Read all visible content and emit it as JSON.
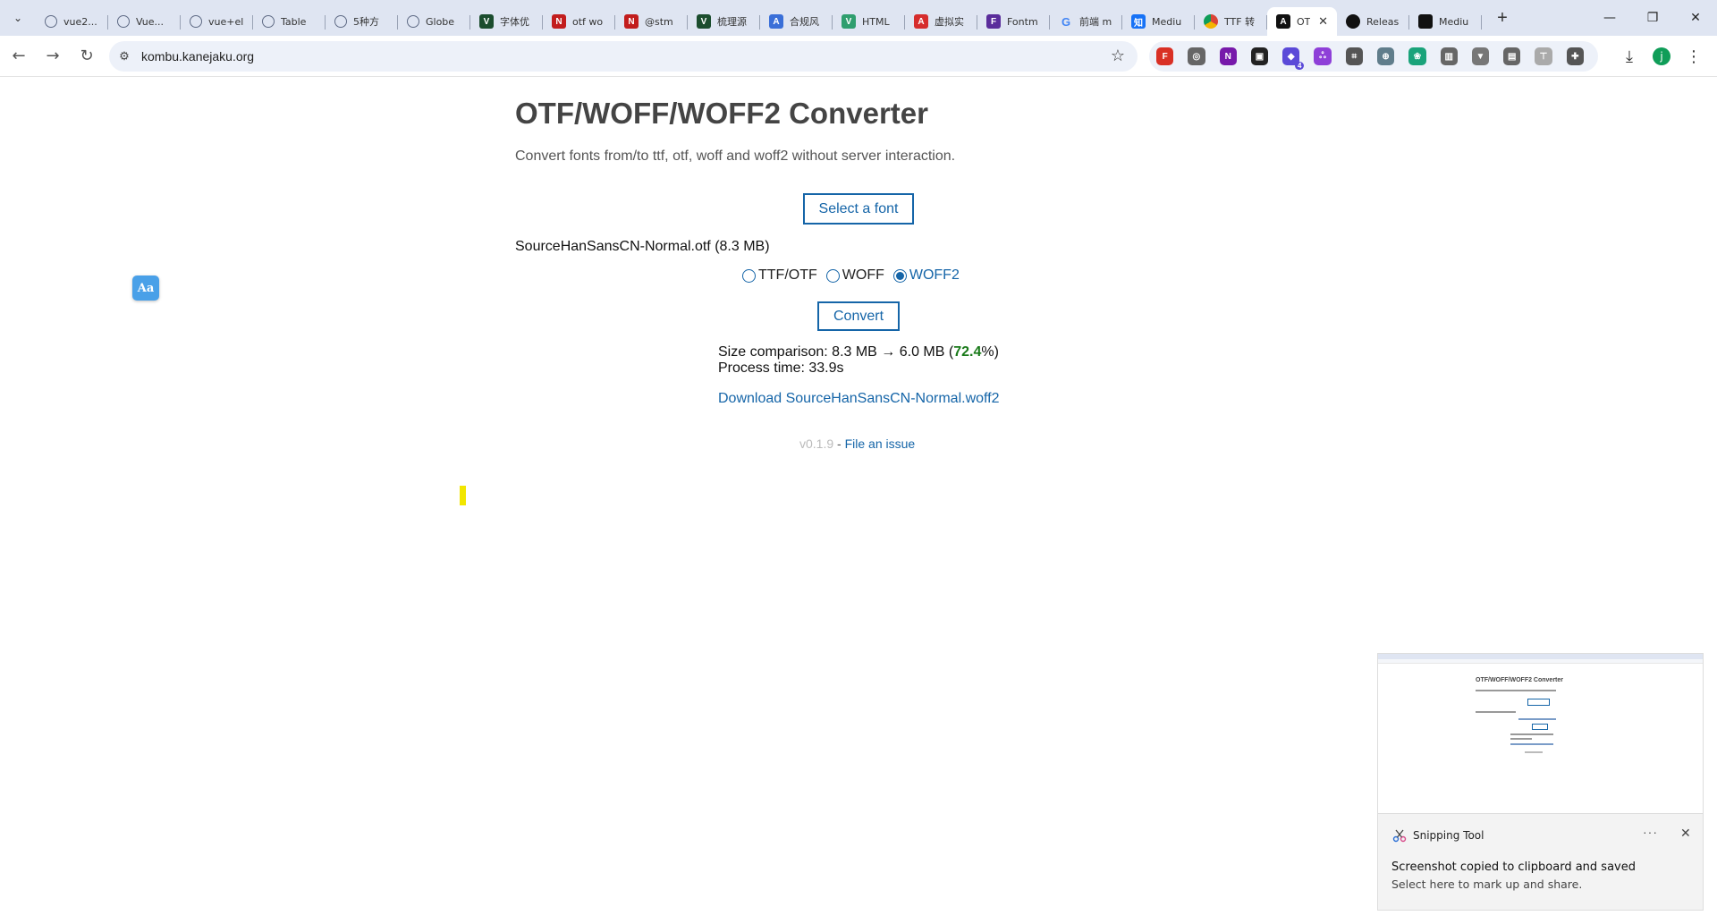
{
  "browser": {
    "tabs": [
      {
        "title": "vue2...",
        "icon": "globe-icon",
        "color": "#5f6b85"
      },
      {
        "title": "Vue...",
        "icon": "globe-icon",
        "color": "#5f6b85"
      },
      {
        "title": "vue+el",
        "icon": "globe-icon",
        "color": "#5f6b85"
      },
      {
        "title": "Table",
        "icon": "globe-icon",
        "color": "#5f6b85"
      },
      {
        "title": "5种方",
        "icon": "openai-icon",
        "color": "#5f6b85"
      },
      {
        "title": "Globe",
        "icon": "globe-icon",
        "color": "#5f6b85"
      },
      {
        "title": "字体优",
        "icon": "v-icon",
        "color": "#1b4d2e"
      },
      {
        "title": "otf wo",
        "icon": "n-icon",
        "color": "#c21d1d"
      },
      {
        "title": "@stm",
        "icon": "n-icon",
        "color": "#c21d1d"
      },
      {
        "title": "梳理源",
        "icon": "v-icon",
        "color": "#1b4d2e"
      },
      {
        "title": "合规风",
        "icon": "a-icon",
        "color": "#3a6fd8"
      },
      {
        "title": "HTML",
        "icon": "vue-icon",
        "color": "#2f9e6e"
      },
      {
        "title": "虚拟实",
        "icon": "a-icon",
        "color": "#d62d2d"
      },
      {
        "title": "Fontm",
        "icon": "f-icon",
        "color": "#5a2d9b"
      },
      {
        "title": "前端 m",
        "icon": "google-icon",
        "color": "#ffffff"
      },
      {
        "title": "Mediu",
        "icon": "zhihu-icon",
        "color": "#1772f6"
      },
      {
        "title": "TTF 转",
        "icon": "chrome-icon",
        "color": "#e9a23b"
      },
      {
        "title": "OT",
        "icon": "a-icon",
        "color": "#111111",
        "active": true
      },
      {
        "title": "Releas",
        "icon": "github-icon",
        "color": "#111111"
      },
      {
        "title": "Mediu",
        "icon": "medium-icon",
        "color": "#111111"
      }
    ],
    "tab_favicon_letters": [
      "",
      "",
      "",
      "",
      "",
      "",
      "V",
      "N",
      "N",
      "V",
      "A",
      "V",
      "A",
      "F",
      "G",
      "知",
      "",
      "A",
      "",
      ""
    ],
    "url": "kombu.kanejaku.org",
    "extensions": [
      {
        "name": "fire-extension-icon",
        "color": "#d93025",
        "letter": "F"
      },
      {
        "name": "globe-extension-icon",
        "color": "#666666",
        "letter": "◎"
      },
      {
        "name": "onenote-extension-icon",
        "color": "#7719aa",
        "letter": "N"
      },
      {
        "name": "puzzle-dark-extension-icon",
        "color": "#222222",
        "letter": "▣"
      },
      {
        "name": "stack-extension-icon",
        "color": "#5b4ad8",
        "letter": "◆",
        "badge": "4"
      },
      {
        "name": "translate-extension-icon",
        "color": "#8e3fd8",
        "letter": "ஃ"
      },
      {
        "name": "crop-extension-icon",
        "color": "#555555",
        "letter": "⌗"
      },
      {
        "name": "shield-extension-icon",
        "color": "#607d8b",
        "letter": "⊕"
      },
      {
        "name": "leaf-extension-icon",
        "color": "#1aa37a",
        "letter": "❀"
      },
      {
        "name": "trash-extension-icon",
        "color": "#666666",
        "letter": "▥"
      },
      {
        "name": "vue-devtools-extension-icon",
        "color": "#777777",
        "letter": "▼"
      },
      {
        "name": "image-extension-icon",
        "color": "#666666",
        "letter": "▤"
      },
      {
        "name": "filter-extension-icon",
        "color": "#aaaaaa",
        "letter": "⊤"
      },
      {
        "name": "extensions-puzzle-icon",
        "color": "#555555",
        "letter": "✚"
      }
    ],
    "profile_initial": "j"
  },
  "page": {
    "title": "OTF/WOFF/WOFF2 Converter",
    "subtitle": "Convert fonts from/to ttf, otf, woff and woff2 without server interaction.",
    "select_button": "Select a font",
    "file_info": "SourceHanSansCN-Normal.otf (8.3 MB)",
    "formats": [
      {
        "label": "TTF/OTF",
        "checked": false
      },
      {
        "label": "WOFF",
        "checked": false
      },
      {
        "label": "WOFF2",
        "checked": true
      }
    ],
    "convert_button": "Convert",
    "result": {
      "size_prefix": "Size comparison: 8.3 MB → 6.0 MB (",
      "ratio": "72.4",
      "size_suffix": "%)",
      "process_time": "Process time: 33.9s"
    },
    "download_link": "Download SourceHanSansCN-Normal.woff2",
    "footer": {
      "version": "v0.1.9",
      "separator": " - ",
      "issue_link": "File an issue"
    },
    "aa_button": "Aa"
  },
  "notification": {
    "thumbnail_title": "OTF/WOFF/WOFF2 Converter",
    "app_name": "Snipping Tool",
    "more_label": "···",
    "close_label": "✕",
    "message": "Screenshot copied to clipboard and saved",
    "sub_message": "Select here to mark up and share."
  },
  "colors": {
    "link": "#1565a8",
    "ratio_green": "#1a7a1a",
    "tabbar_bg": "#dfe5f2"
  }
}
